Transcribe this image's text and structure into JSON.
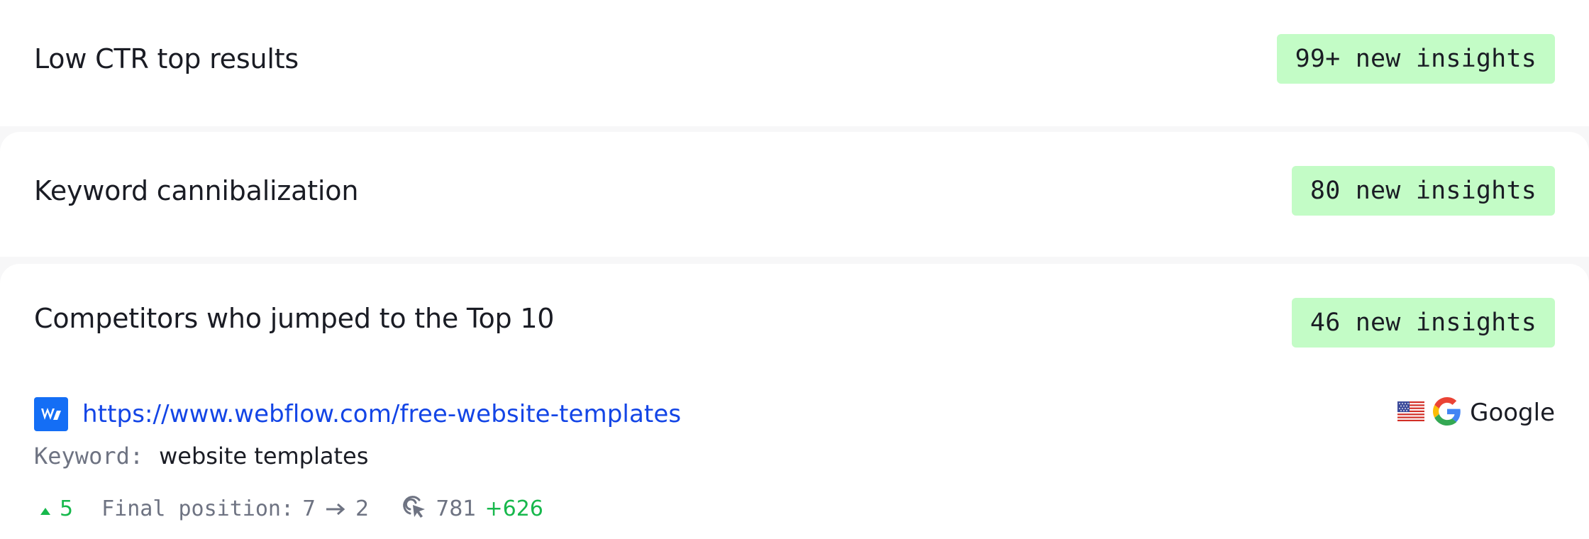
{
  "cards": [
    {
      "title": "Low CTR top results",
      "badge": "99+ new insights"
    },
    {
      "title": "Keyword cannibalization",
      "badge": "80 new insights"
    },
    {
      "title": "Competitors who jumped to the Top 10",
      "badge": "46 new insights"
    }
  ],
  "insight": {
    "site_icon": "webflow-logo-icon",
    "url": "https://www.webflow.com/free-website-templates",
    "country_icon": "us-flag-icon",
    "engine_icon": "google-logo-icon",
    "engine": "Google",
    "keyword_label": "Keyword:",
    "keyword": "website templates",
    "position_change": "5",
    "final_label": "Final position:",
    "position_from": "7",
    "position_to": "2",
    "clicks_icon": "cursor-click-icon",
    "clicks": "781",
    "clicks_delta": "+626"
  },
  "colors": {
    "badge_bg": "#c3fcc6",
    "link": "#1345e6",
    "positive": "#17b84c",
    "muted": "#6e7382"
  }
}
